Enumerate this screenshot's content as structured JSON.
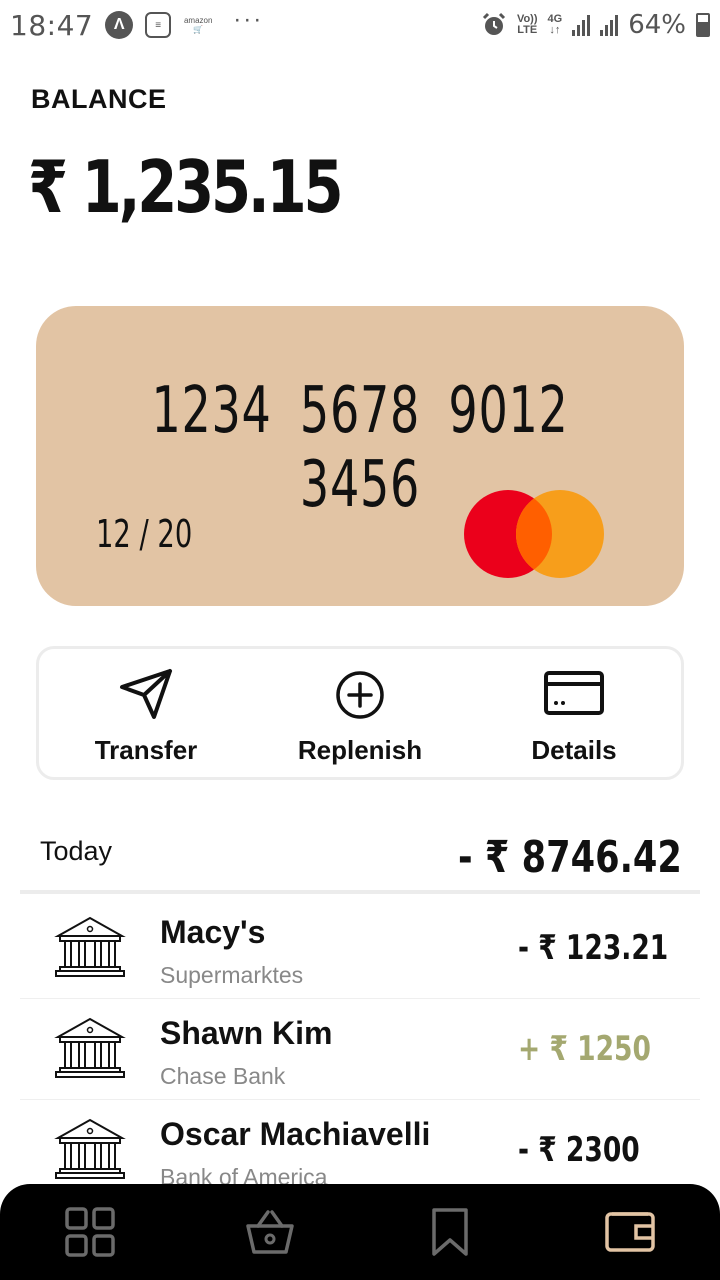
{
  "status_bar": {
    "time": "18:47",
    "amazon_label": "amazon",
    "volte_top": "Vo))",
    "volte_bottom": "LTE",
    "network_top": "4G",
    "network_bottom": "↓↑",
    "battery": "64%",
    "more": "···"
  },
  "balance": {
    "label": "BALANCE",
    "amount": "₹ 1,235.15"
  },
  "card": {
    "number": "1234 5678 9012 3456",
    "expiry": "12 / 20",
    "logo": "mastercard-logo"
  },
  "actions": [
    {
      "label": "Transfer",
      "icon": "send-icon"
    },
    {
      "label": "Replenish",
      "icon": "plus-circle-icon"
    },
    {
      "label": "Details",
      "icon": "card-icon"
    }
  ],
  "today": {
    "label": "Today",
    "total": "- ₹ 8746.42"
  },
  "transactions": [
    {
      "name": "Macy's",
      "subtitle": "Supermarktes",
      "amount": "- ₹ 123.21",
      "type": "debit",
      "icon": "bank-icon"
    },
    {
      "name": "Shawn Kim",
      "subtitle": "Chase Bank",
      "amount": "+ ₹ 1250",
      "type": "credit",
      "icon": "bank-icon"
    },
    {
      "name": "Oscar Machiavelli",
      "subtitle": "Bank of America",
      "amount": "- ₹ 2300",
      "type": "debit",
      "icon": "bank-icon"
    }
  ],
  "colors": {
    "card_background": "#e2c4a4",
    "credit_amount": "#a4a870",
    "nav_active": "#e2c4a4",
    "nav_inactive": "#6b6b6b"
  },
  "bottom_nav": [
    {
      "icon": "grid-icon",
      "active": false
    },
    {
      "icon": "basket-icon",
      "active": false
    },
    {
      "icon": "bookmark-icon",
      "active": false
    },
    {
      "icon": "wallet-icon",
      "active": true
    }
  ]
}
